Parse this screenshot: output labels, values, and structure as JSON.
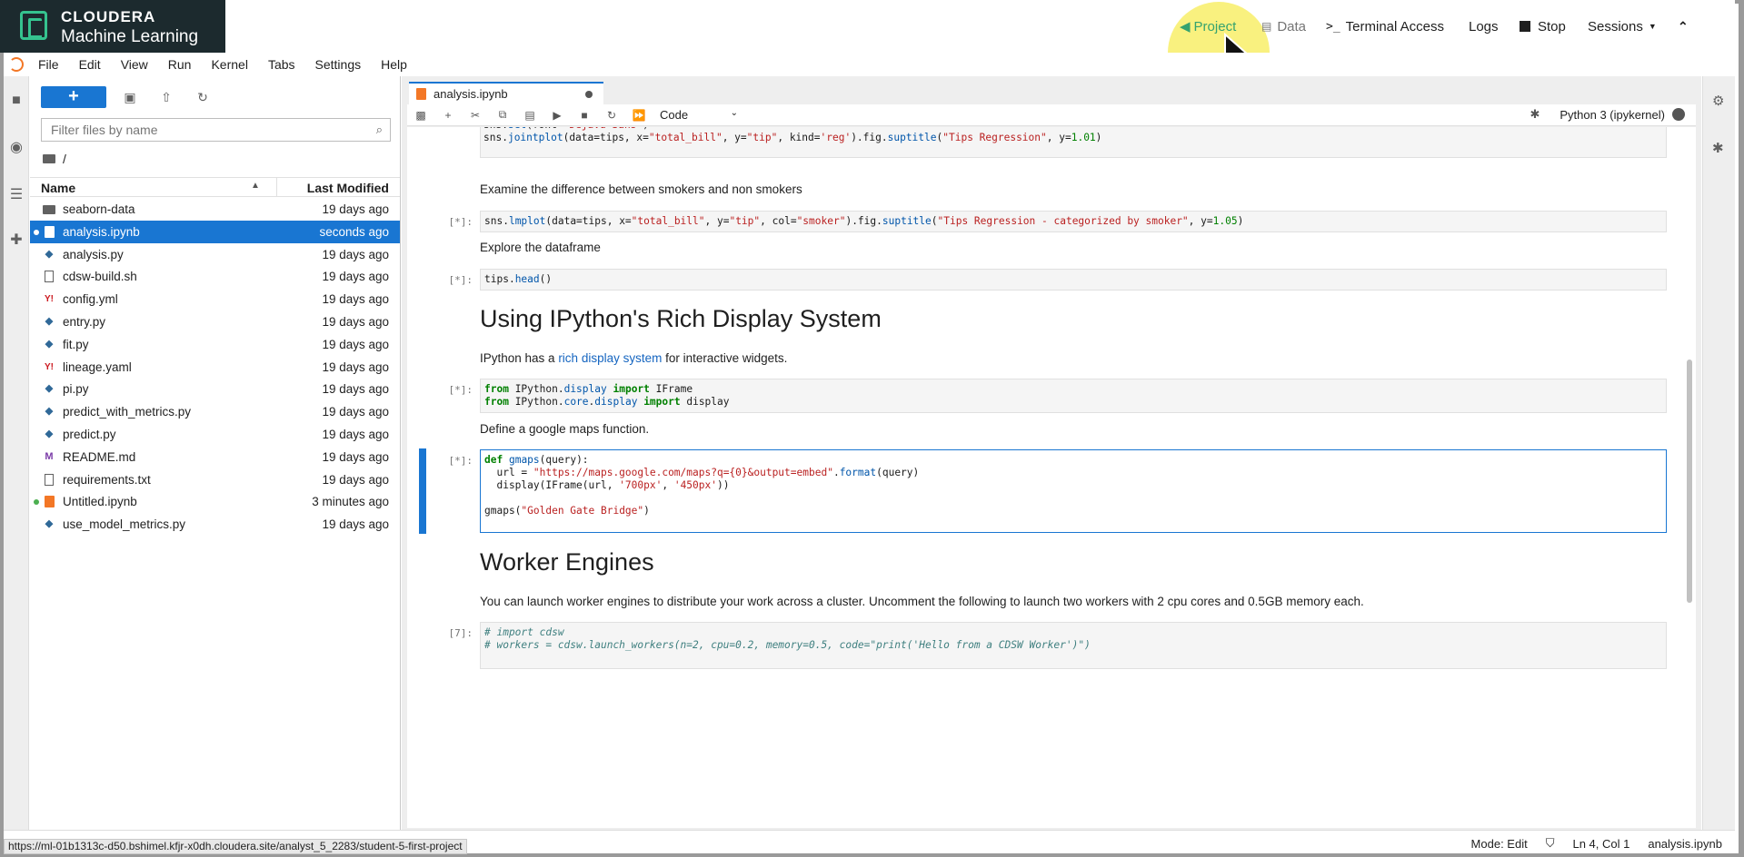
{
  "app": {
    "brand_line1": "CLOUDERA",
    "brand_line2": "Machine Learning",
    "nav": {
      "project": "Project",
      "data": "Data",
      "terminal": "Terminal Access",
      "logs": "Logs",
      "stop": "Stop",
      "sessions": "Sessions"
    }
  },
  "menu": [
    "File",
    "Edit",
    "View",
    "Run",
    "Kernel",
    "Tabs",
    "Settings",
    "Help"
  ],
  "filebrowser": {
    "filter_placeholder": "Filter files by name",
    "path": "/",
    "col_name": "Name",
    "col_modified": "Last Modified",
    "files": [
      {
        "name": "seaborn-data",
        "type": "folder",
        "modified": "19 days ago",
        "selected": false,
        "running": false
      },
      {
        "name": "analysis.ipynb",
        "type": "notebook",
        "modified": "seconds ago",
        "selected": true,
        "running": true
      },
      {
        "name": "analysis.py",
        "type": "python",
        "modified": "19 days ago",
        "selected": false,
        "running": false
      },
      {
        "name": "cdsw-build.sh",
        "type": "file",
        "modified": "19 days ago",
        "selected": false,
        "running": false
      },
      {
        "name": "config.yml",
        "type": "yaml",
        "modified": "19 days ago",
        "selected": false,
        "running": false
      },
      {
        "name": "entry.py",
        "type": "python",
        "modified": "19 days ago",
        "selected": false,
        "running": false
      },
      {
        "name": "fit.py",
        "type": "python",
        "modified": "19 days ago",
        "selected": false,
        "running": false
      },
      {
        "name": "lineage.yaml",
        "type": "yaml",
        "modified": "19 days ago",
        "selected": false,
        "running": false
      },
      {
        "name": "pi.py",
        "type": "python",
        "modified": "19 days ago",
        "selected": false,
        "running": false
      },
      {
        "name": "predict_with_metrics.py",
        "type": "python",
        "modified": "19 days ago",
        "selected": false,
        "running": false
      },
      {
        "name": "predict.py",
        "type": "python",
        "modified": "19 days ago",
        "selected": false,
        "running": false
      },
      {
        "name": "README.md",
        "type": "markdown",
        "modified": "19 days ago",
        "selected": false,
        "running": false
      },
      {
        "name": "requirements.txt",
        "type": "file",
        "modified": "19 days ago",
        "selected": false,
        "running": false
      },
      {
        "name": "Untitled.ipynb",
        "type": "notebook",
        "modified": "3 minutes ago",
        "selected": false,
        "running": true
      },
      {
        "name": "use_model_metrics.py",
        "type": "python",
        "modified": "19 days ago",
        "selected": false,
        "running": false
      }
    ]
  },
  "notebook": {
    "tab_title": "analysis.ipynb",
    "cell_type": "Code",
    "kernel_name": "Python 3 (ipykernel)",
    "md_examine": "Examine the difference between smokers and non smokers",
    "md_explore": "Explore the dataframe",
    "heading_rich": "Using IPython's Rich Display System",
    "md_rich_prefix": "IPython has a ",
    "md_rich_link": "rich display system",
    "md_rich_suffix": " for interactive widgets.",
    "md_gmaps": "Define a google maps function.",
    "heading_workers": "Worker Engines",
    "md_workers": "You can launch worker engines to distribute your work across a cluster. Uncomment the following to launch two workers with 2 cpu cores and 0.5GB memory each.",
    "prompts": [
      "[*]:",
      "[*]:",
      "[*]:",
      "[*]:",
      "[7]:"
    ]
  },
  "statusbar": {
    "url": "https://ml-01b1313c-d50.bshimel.kfjr-x0dh.cloudera.site/analyst_5_2283/student-5-first-project",
    "mode": "Mode: Edit",
    "position": "Ln 4, Col 1",
    "filename": "analysis.ipynb"
  },
  "colors": {
    "accent": "#1976d2",
    "brand_dark": "#1c2a2e",
    "brand_green": "#35c38f",
    "cursor_highlight": "#f7ec54"
  }
}
